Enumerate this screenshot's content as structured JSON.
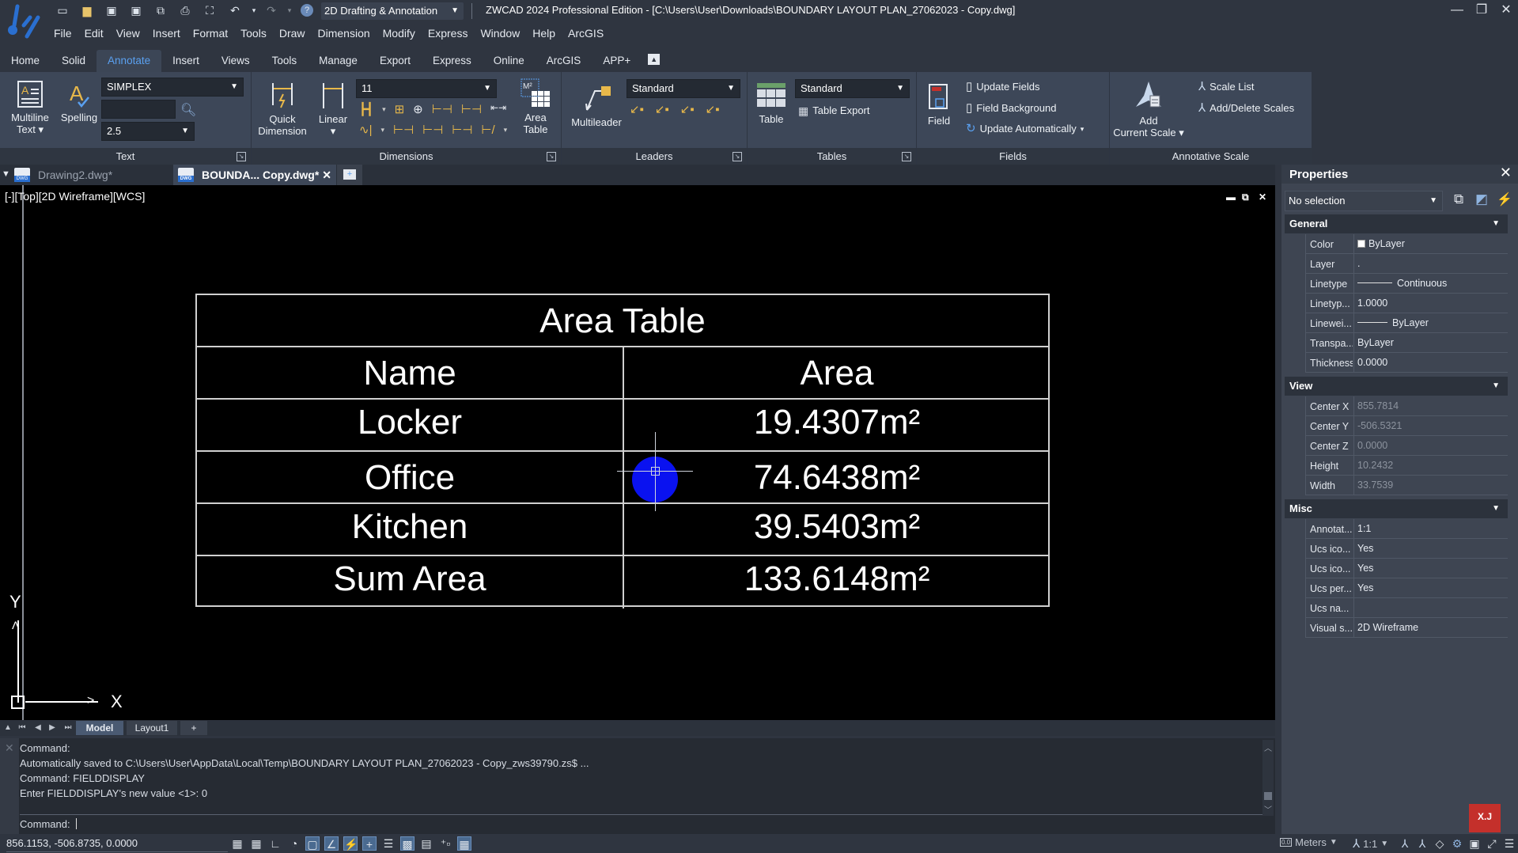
{
  "app": {
    "workspace": "2D Drafting & Annotation",
    "title": "ZWCAD 2024 Professional Edition - [C:\\Users\\User\\Downloads\\BOUNDARY LAYOUT PLAN_27062023 - Copy.dwg]"
  },
  "menu": [
    "File",
    "Edit",
    "View",
    "Insert",
    "Format",
    "Tools",
    "Draw",
    "Dimension",
    "Modify",
    "Express",
    "Window",
    "Help",
    "ArcGIS"
  ],
  "ribbon_tabs": [
    "Home",
    "Solid",
    "Annotate",
    "Insert",
    "Views",
    "Tools",
    "Manage",
    "Export",
    "Express",
    "Online",
    "ArcGIS",
    "APP+"
  ],
  "active_ribbon_tab": "Annotate",
  "ribbon": {
    "text": {
      "label": "Text",
      "multiline_line1": "Multiline",
      "multiline_line2": "Text ▾",
      "spelling": "Spelling",
      "font": "SIMPLEX",
      "find_value": "",
      "height": "2.5"
    },
    "dimensions": {
      "label": "Dimensions",
      "quick_line1": "Quick",
      "quick_line2": "Dimension",
      "linear": "Linear",
      "linear_arrow": "▾",
      "style": "11",
      "area_line1": "Area",
      "area_line2": "Table"
    },
    "leaders": {
      "label": "Leaders",
      "multileader": "Multileader",
      "style": "Standard"
    },
    "tables": {
      "label": "Tables",
      "table": "Table",
      "style": "Standard",
      "export": "Table Export"
    },
    "fields": {
      "label": "Fields",
      "field": "Field",
      "update": "Update Fields",
      "background": "Field Background",
      "auto": "Update Automatically"
    },
    "annotative": {
      "label": "Annotative Scale",
      "add_line1": "Add",
      "add_line2": "Current Scale ▾",
      "scale_list": "Scale List",
      "add_delete": "Add/Delete Scales"
    }
  },
  "doc_tabs": [
    {
      "label": "Drawing2.dwg*",
      "active": false
    },
    {
      "label": "BOUNDA... Copy.dwg*",
      "active": true
    }
  ],
  "viewport": {
    "label": "[-][Top][2D Wireframe][WCS]"
  },
  "area_table": {
    "title": "Area Table",
    "headers": [
      "Name",
      "Area"
    ],
    "rows": [
      [
        "Locker",
        "19.4307m²"
      ],
      [
        "Office",
        "74.6438m²"
      ],
      [
        "Kitchen",
        "39.5403m²"
      ],
      [
        "Sum Area",
        "133.6148m²"
      ]
    ]
  },
  "ucs": {
    "x": "X",
    "y": "Y"
  },
  "layout_tabs": [
    "Model",
    "Layout1",
    "+"
  ],
  "command": {
    "history": [
      "Command:",
      "Automatically saved to C:\\Users\\User\\AppData\\Local\\Temp\\BOUNDARY LAYOUT PLAN_27062023 - Copy_zws39790.zs$ ...",
      "Command: FIELDDISPLAY",
      "Enter FIELDDISPLAY's new value  <1>: 0"
    ],
    "prompt": "Command:"
  },
  "status": {
    "coords": "856.1153, -506.8735, 0.0000",
    "units": "Meters",
    "scale": "1:1"
  },
  "properties": {
    "title": "Properties",
    "selection": "No selection",
    "sections": [
      {
        "name": "General",
        "rows": [
          {
            "label": "Color",
            "value": "ByLayer"
          },
          {
            "label": "Layer",
            "value": "."
          },
          {
            "label": "Linetype",
            "value": "Continuous"
          },
          {
            "label": "Linetyp...",
            "value": "1.0000"
          },
          {
            "label": "Linewei...",
            "value": "ByLayer"
          },
          {
            "label": "Transpa...",
            "value": "ByLayer"
          },
          {
            "label": "Thickness",
            "value": "0.0000"
          }
        ]
      },
      {
        "name": "View",
        "rows": [
          {
            "label": "Center X",
            "value": "855.7814"
          },
          {
            "label": "Center Y",
            "value": "-506.5321"
          },
          {
            "label": "Center Z",
            "value": "0.0000"
          },
          {
            "label": "Height",
            "value": "10.2432"
          },
          {
            "label": "Width",
            "value": "33.7539"
          }
        ]
      },
      {
        "name": "Misc",
        "rows": [
          {
            "label": "Annotat...",
            "value": "1:1"
          },
          {
            "label": "Ucs ico...",
            "value": "Yes"
          },
          {
            "label": "Ucs ico...",
            "value": "Yes"
          },
          {
            "label": "Ucs per...",
            "value": "Yes"
          },
          {
            "label": "Ucs na...",
            "value": ""
          },
          {
            "label": "Visual s...",
            "value": "2D Wireframe"
          }
        ]
      }
    ]
  },
  "colors": {
    "accent": "#5aa0f0",
    "ribbon_bg": "#3d4758",
    "canvas_bg": "#000000",
    "cursor": "#0a12f0"
  }
}
